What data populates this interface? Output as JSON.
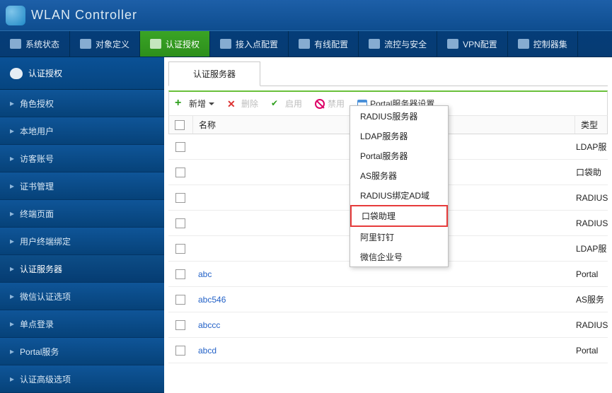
{
  "header": {
    "product": "WLAN Controller"
  },
  "topnav": [
    {
      "label": "系统状态"
    },
    {
      "label": "对象定义"
    },
    {
      "label": "认证授权",
      "active": true
    },
    {
      "label": "接入点配置"
    },
    {
      "label": "有线配置"
    },
    {
      "label": "流控与安全"
    },
    {
      "label": "VPN配置"
    },
    {
      "label": "控制器集"
    }
  ],
  "sidebar": {
    "title": "认证授权",
    "items": [
      "角色授权",
      "本地用户",
      "访客账号",
      "证书管理",
      "终端页面",
      "用户终端绑定",
      "认证服务器",
      "微信认证选项",
      "单点登录",
      "Portal服务",
      "认证高级选项"
    ],
    "activeIndex": 6
  },
  "tab": {
    "label": "认证服务器"
  },
  "toolbar": {
    "add": "新增",
    "delete": "删除",
    "enable": "启用",
    "disable": "禁用",
    "portal": "Portal服务器设置"
  },
  "dropdown": [
    "RADIUS服务器",
    "LDAP服务器",
    "Portal服务器",
    "AS服务器",
    "RADIUS绑定AD域",
    "口袋助理",
    "阿里钉钉",
    "微信企业号"
  ],
  "dropdownHighlight": 5,
  "table": {
    "headers": {
      "name": "名称",
      "type": "类型"
    },
    "rows": [
      {
        "name": "",
        "type": "LDAP服"
      },
      {
        "name": "",
        "type": "口袋助"
      },
      {
        "name": "",
        "type": "RADIUS"
      },
      {
        "name": "",
        "type": "RADIUS"
      },
      {
        "name": "",
        "type": "LDAP服"
      },
      {
        "name": "abc",
        "type": "Portal"
      },
      {
        "name": "abc546",
        "type": "AS服务"
      },
      {
        "name": "abccc",
        "type": "RADIUS"
      },
      {
        "name": "abcd",
        "type": "Portal"
      }
    ]
  }
}
